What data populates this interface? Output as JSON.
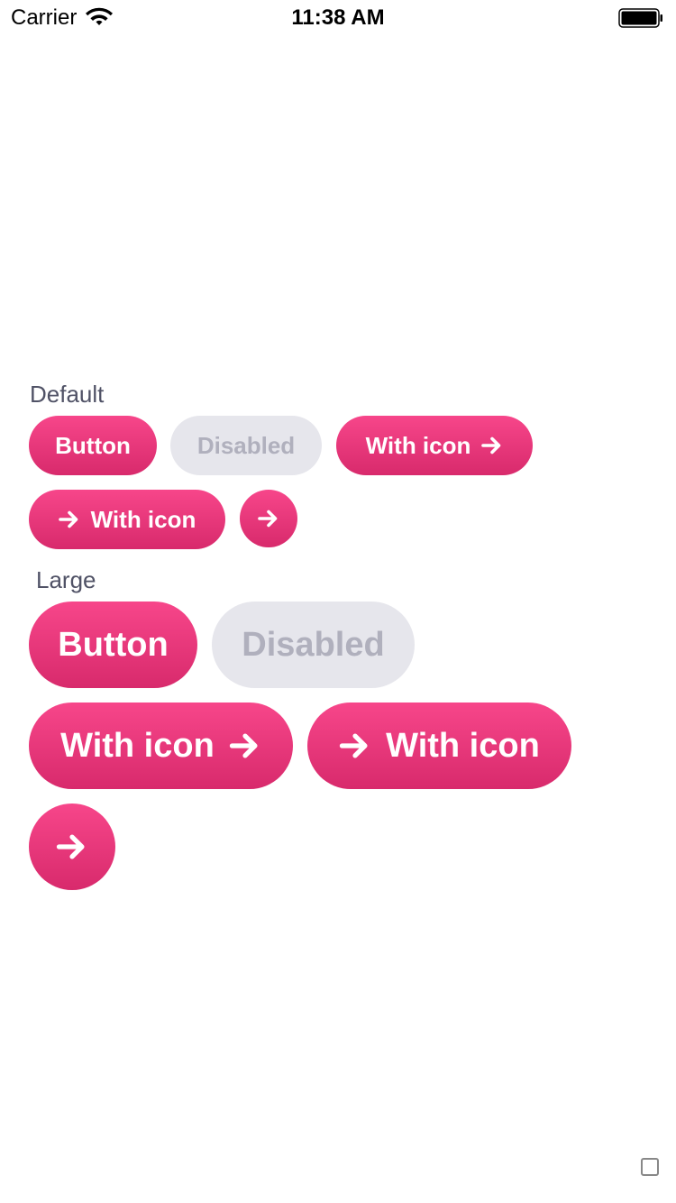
{
  "status_bar": {
    "carrier": "Carrier",
    "time": "11:38 AM"
  },
  "sections": {
    "default": {
      "label": "Default",
      "button": "Button",
      "disabled": "Disabled",
      "with_icon": "With icon"
    },
    "large": {
      "label": "Large",
      "button": "Button",
      "disabled": "Disabled",
      "with_icon": "With icon"
    }
  },
  "icons": {
    "arrow": "arrow-right-icon",
    "wifi": "wifi-icon",
    "battery": "battery-icon"
  },
  "colors": {
    "primary_top": "#f7468a",
    "primary_bottom": "#d82a6c",
    "disabled_bg": "#e6e6ec",
    "disabled_text": "#b0b0bd",
    "label_text": "#505266"
  }
}
